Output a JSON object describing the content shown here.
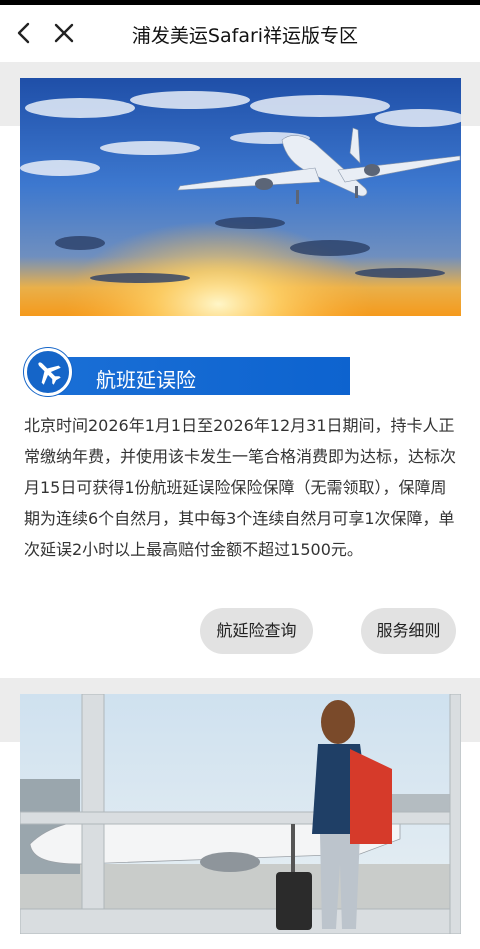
{
  "nav": {
    "title": "浦发美运Safari祥运版专区",
    "back_icon": "chevron-left-icon",
    "close_icon": "close-icon"
  },
  "section": {
    "badge_label": "航班延误险",
    "badge_icon": "airplane-icon",
    "description": "北京时间2026年1月1日至2026年12月31日期间，持卡人正常缴纳年费，并使用该卡发生一笔合格消费即为达标，达标次月15日可获得1份航班延误险保险保障（无需领取），保障周期为连续6个自然月，其中每3个连续自然月可享1次保障，单次延误2小时以上最高赔付金额不超过1500元。",
    "buttons": {
      "query": "航延险查询",
      "rules": "服务细则"
    }
  },
  "colors": {
    "accent": "#1565c8",
    "pill_bg": "#e2e2e2",
    "band": "#ececec"
  }
}
